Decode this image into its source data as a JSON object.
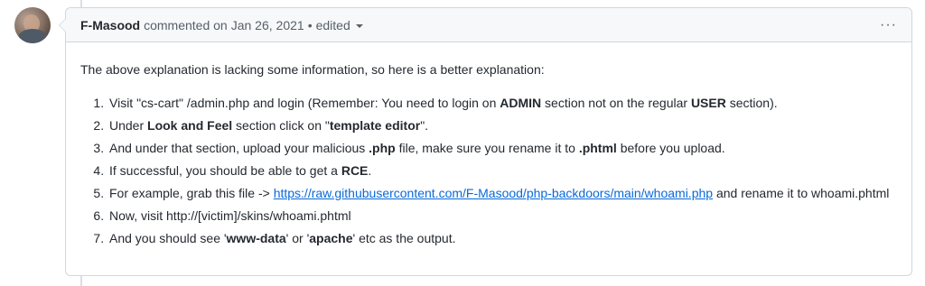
{
  "header": {
    "author": "F-Masood",
    "action": "commented on",
    "date": "Jan 26, 2021",
    "bullet": "•",
    "edited": "edited",
    "more": "···"
  },
  "body": {
    "intro": "The above explanation is lacking some information, so here is a better explanation:",
    "steps": {
      "s1": {
        "a": "Visit \"cs-cart\" /admin.php and login (Remember: You need to login on ",
        "b": "ADMIN",
        "c": " section not on the regular ",
        "d": "USER",
        "e": " section)."
      },
      "s2": {
        "a": "Under ",
        "b": "Look and Feel",
        "c": " section click on \"",
        "d": "template editor",
        "e": "\"."
      },
      "s3": {
        "a": "And under that section, upload your malicious ",
        "b": ".php",
        "c": " file, make sure you rename it to ",
        "d": ".phtml",
        "e": " before you upload."
      },
      "s4": {
        "a": "If successful, you should be able to get a ",
        "b": "RCE",
        "c": "."
      },
      "s5": {
        "a": "For example, grab this file -> ",
        "link": "https://raw.githubusercontent.com/F-Masood/php-backdoors/main/whoami.php",
        "c": " and rename it to whoami.phtml"
      },
      "s6": {
        "a": "Now, visit http://[victim]/skins/whoami.phtml"
      },
      "s7": {
        "a": "And you should see '",
        "b": "www-data",
        "c": "' or '",
        "d": "apache",
        "e": "' etc as the output."
      }
    }
  },
  "colors": {
    "link": "#0969da",
    "border": "#d0d7de",
    "header_bg": "#f6f8fa",
    "muted_text": "#57606a",
    "text": "#24292f"
  },
  "icons": {
    "more": "kebab-horizontal-icon",
    "dropdown": "triangle-down-icon"
  }
}
